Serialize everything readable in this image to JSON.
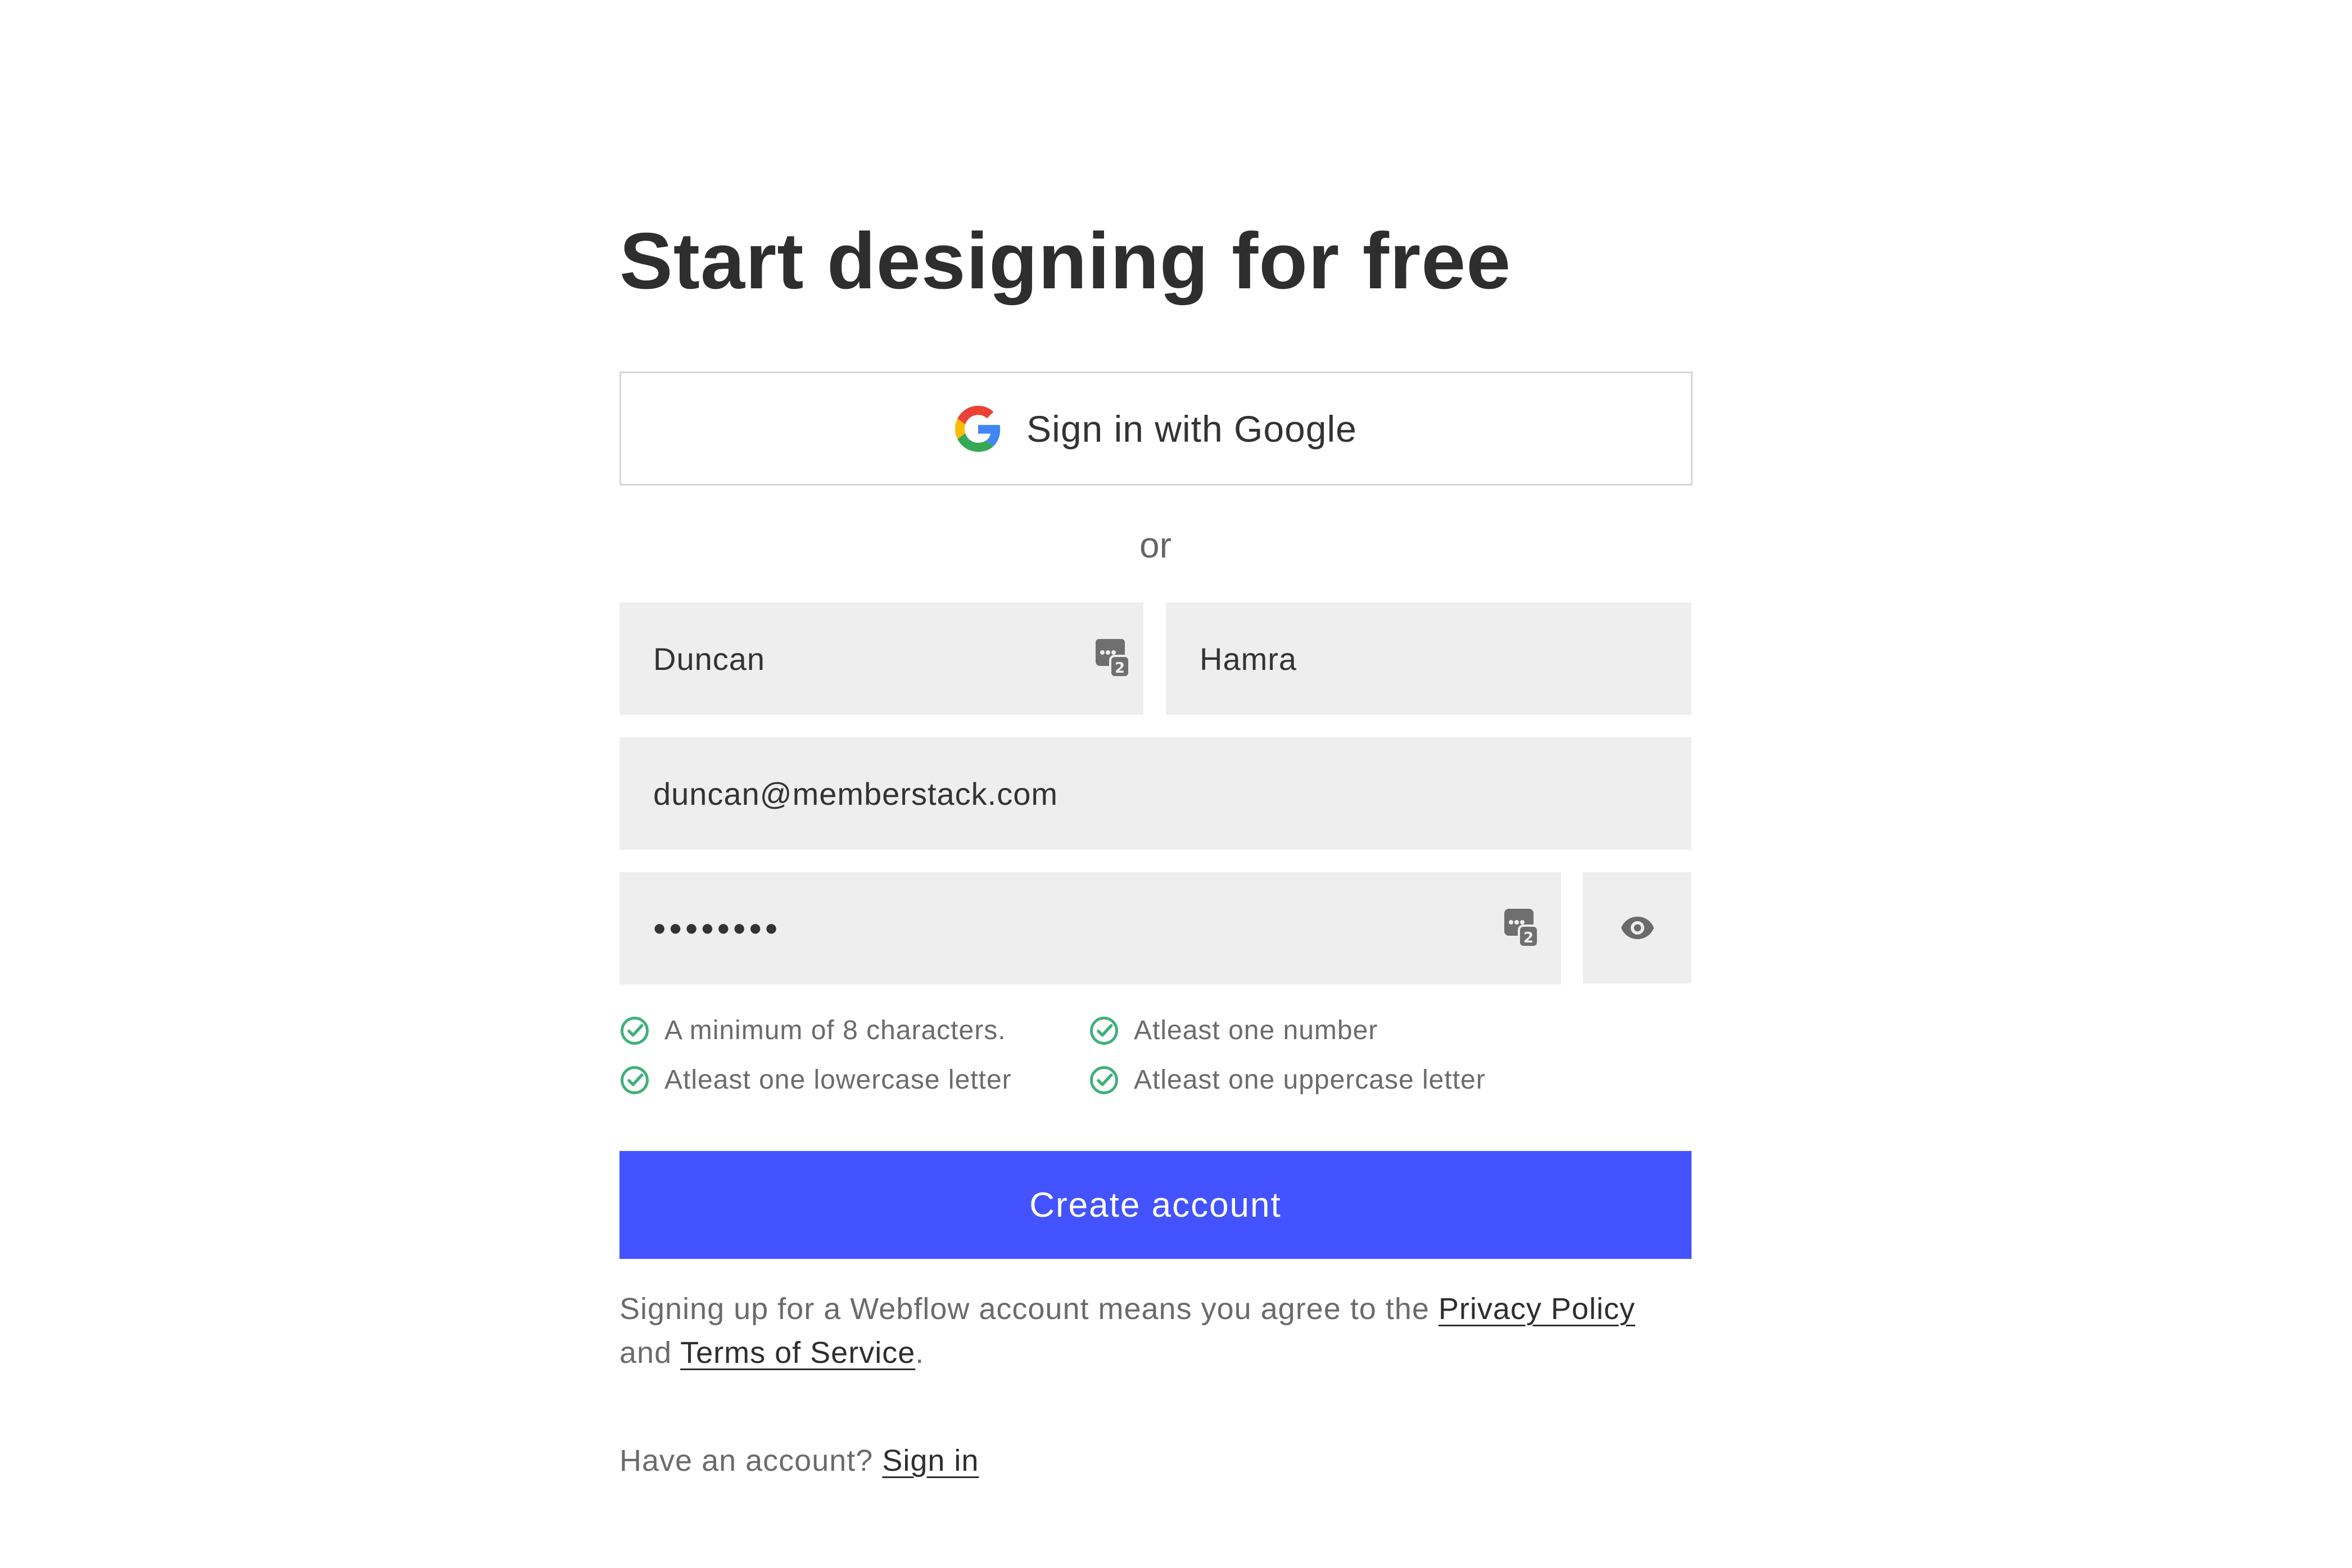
{
  "page": {
    "title": "Start designing for free"
  },
  "google": {
    "label": "Sign in with Google",
    "icon": "google-logo-icon"
  },
  "divider": {
    "text": "or"
  },
  "fields": {
    "first_name": {
      "value": "Duncan",
      "icon": "password-manager-icon"
    },
    "last_name": {
      "value": "Hamra"
    },
    "email": {
      "value": "duncan@memberstack.com"
    },
    "password": {
      "value": "••••••••",
      "icon": "password-manager-icon"
    },
    "toggle_icon": "eye-icon"
  },
  "requirements": [
    {
      "text": "A minimum of 8 characters.",
      "met": true
    },
    {
      "text": "Atleast one number",
      "met": true
    },
    {
      "text": "Atleast one lowercase letter",
      "met": true
    },
    {
      "text": "Atleast one uppercase letter",
      "met": true
    }
  ],
  "create": {
    "label": "Create account"
  },
  "terms": {
    "prefix": "Signing up for a Webflow account means you agree to the ",
    "privacy": "Privacy Policy",
    "and": "and ",
    "tos": "Terms of Service",
    "suffix": "."
  },
  "signin": {
    "prefix": "Have an account? ",
    "link": "Sign in"
  },
  "colors": {
    "accent": "#4353ff",
    "field_bg": "#eeeeee",
    "check": "#3fb07a"
  }
}
